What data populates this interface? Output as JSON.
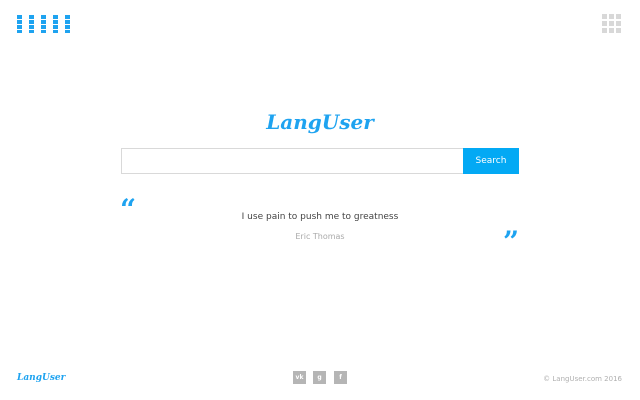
{
  "header": {
    "bars_icon": "bars-menu-icon",
    "apps_icon": "app-grid-icon"
  },
  "brand": {
    "logo": "LangUser",
    "color": "#1ea3f0"
  },
  "search": {
    "value": "",
    "placeholder": "",
    "button_label": "Search",
    "button_color": "#03a9f4"
  },
  "quote": {
    "open_mark": "“",
    "text": "I use pain to push me to greatness",
    "author": "Eric Thomas",
    "close_mark": "”"
  },
  "footer": {
    "logo": "LangUser",
    "social": {
      "vk": "vk",
      "google": "g",
      "facebook": "f"
    },
    "copyright": "© LangUser.com 2016"
  }
}
